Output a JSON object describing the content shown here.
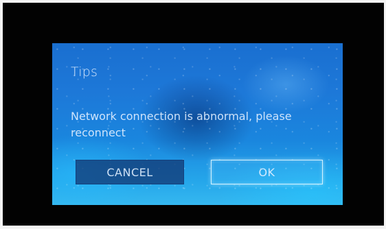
{
  "dialog": {
    "title": "Tips",
    "message": "Network connection is abnormal, please reconnect",
    "cancel_label": "CANCEL",
    "ok_label": "OK"
  },
  "colors": {
    "frame_background": "#020202",
    "dialog_gradient_top": "#1a6fd0",
    "dialog_gradient_bottom": "#35b8f0",
    "cancel_button_fill": "#123a76",
    "ok_button_border": "#dcf5ff"
  }
}
